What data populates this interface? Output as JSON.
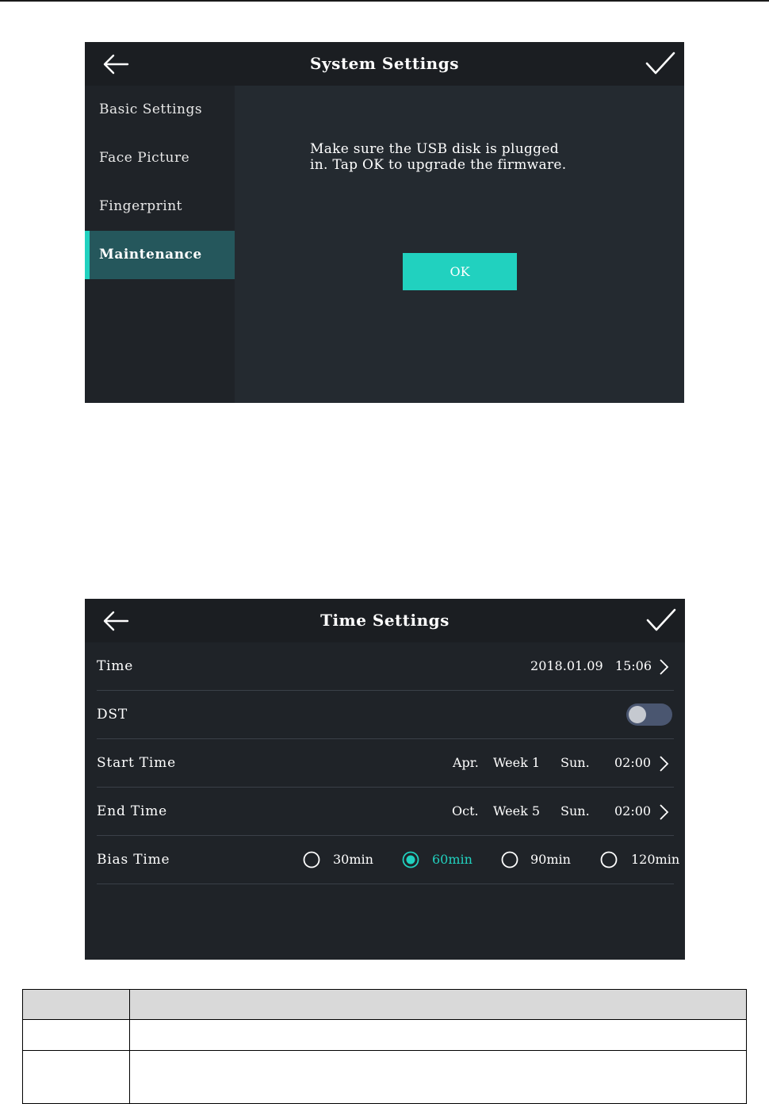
{
  "system_settings": {
    "title": "System Settings",
    "sidebar": [
      {
        "label": "Basic Settings",
        "active": false
      },
      {
        "label": "Face Picture",
        "active": false
      },
      {
        "label": "Fingerprint",
        "active": false
      },
      {
        "label": "Maintenance",
        "active": true
      }
    ],
    "message_line1": "Make sure the USB disk is plugged",
    "message_line2": "in. Tap OK to upgrade the firmware.",
    "ok_label": "OK"
  },
  "time_settings": {
    "title": "Time Settings",
    "time": {
      "label": "Time",
      "value": "2018.01.09   15:06"
    },
    "dst": {
      "label": "DST",
      "enabled": false
    },
    "start_time": {
      "label": "Start Time",
      "month": "Apr.",
      "week": "Week 1",
      "day": "Sun.",
      "time": "02:00"
    },
    "end_time": {
      "label": "End Time",
      "month": "Oct.",
      "week": "Week 5",
      "day": "Sun.",
      "time": "02:00"
    },
    "bias_time": {
      "label": "Bias Time",
      "options": [
        "30min",
        "60min",
        "90min",
        "120min"
      ],
      "selected": "60min"
    }
  },
  "colors": {
    "accent": "#21d1bf",
    "screen_bg": "#1f2328",
    "active_item_bg": "#25575c",
    "toggle_off": "#4a5670"
  },
  "table": {
    "header": [
      "",
      ""
    ],
    "rows": [
      [
        "",
        ""
      ],
      [
        "",
        ""
      ]
    ]
  }
}
